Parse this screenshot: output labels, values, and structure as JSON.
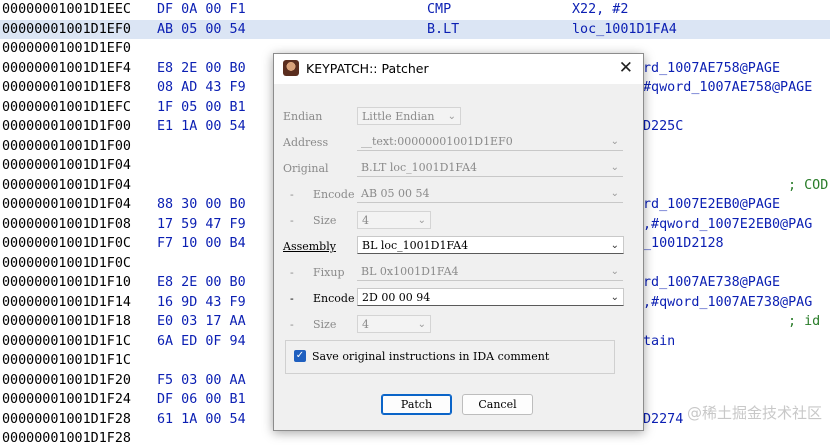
{
  "listing": {
    "rows": [
      {
        "addr": "00000001001D1EEC",
        "bytes": "DF 0A 00 F1",
        "mnem": "CMP",
        "oper": "X22, #2",
        "tail": "",
        "cmt": ""
      },
      {
        "addr": "00000001001D1EF0",
        "bytes": "AB 05 00 54",
        "mnem": "B.LT",
        "oper": "loc_1001D1FA4",
        "tail": "",
        "cmt": ""
      },
      {
        "addr": "00000001001D1EF0",
        "bytes": "",
        "mnem": "",
        "oper": "",
        "tail": "",
        "cmt": ""
      },
      {
        "addr": "00000001001D1EF4",
        "bytes": "E8 2E 00 B0",
        "mnem": "",
        "oper": "",
        "tail": "rd_1007AE758@PAGE",
        "cmt": ""
      },
      {
        "addr": "00000001001D1EF8",
        "bytes": "08 AD 43 F9",
        "mnem": "",
        "oper": "",
        "tail": "#qword_1007AE758@PAGE",
        "cmt": ""
      },
      {
        "addr": "00000001001D1EFC",
        "bytes": "1F 05 00 B1",
        "mnem": "",
        "oper": "",
        "tail": "",
        "cmt": ""
      },
      {
        "addr": "00000001001D1F00",
        "bytes": "E1 1A 00 54",
        "mnem": "",
        "oper": "",
        "tail": "D225C",
        "cmt": ""
      },
      {
        "addr": "00000001001D1F00",
        "bytes": "",
        "mnem": "",
        "oper": "",
        "tail": "",
        "cmt": ""
      },
      {
        "addr": "00000001001D1F04",
        "bytes": "",
        "mnem": "",
        "oper": "",
        "tail": "",
        "cmt": ""
      },
      {
        "addr": "00000001001D1F04",
        "bytes": "",
        "mnem": "",
        "oper": "",
        "tail": "",
        "cmt": "; COD"
      },
      {
        "addr": "00000001001D1F04",
        "bytes": "88 30 00 B0",
        "mnem": "",
        "oper": "",
        "tail": "rd_1007E2EB0@PAGE",
        "cmt": ""
      },
      {
        "addr": "00000001001D1F08",
        "bytes": "17 59 47 F9",
        "mnem": "",
        "oper": "",
        "tail": ",#qword_1007E2EB0@PAG",
        "cmt": ""
      },
      {
        "addr": "00000001001D1F0C",
        "bytes": "F7 10 00 B4",
        "mnem": "",
        "oper": "",
        "tail": "_1001D2128",
        "cmt": ""
      },
      {
        "addr": "00000001001D1F0C",
        "bytes": "",
        "mnem": "",
        "oper": "",
        "tail": "",
        "cmt": ""
      },
      {
        "addr": "00000001001D1F10",
        "bytes": "E8 2E 00 B0",
        "mnem": "",
        "oper": "",
        "tail": "rd_1007AE738@PAGE",
        "cmt": ""
      },
      {
        "addr": "00000001001D1F14",
        "bytes": "16 9D 43 F9",
        "mnem": "",
        "oper": "",
        "tail": ",#qword_1007AE738@PAG",
        "cmt": ""
      },
      {
        "addr": "00000001001D1F18",
        "bytes": "E0 03 17 AA",
        "mnem": "",
        "oper": "",
        "tail": "",
        "cmt": "; id"
      },
      {
        "addr": "00000001001D1F1C",
        "bytes": "6A ED 0F 94",
        "mnem": "",
        "oper": "",
        "tail": "tain",
        "cmt": ""
      },
      {
        "addr": "00000001001D1F1C",
        "bytes": "",
        "mnem": "",
        "oper": "",
        "tail": "",
        "cmt": ""
      },
      {
        "addr": "00000001001D1F20",
        "bytes": "F5 03 00 AA",
        "mnem": "",
        "oper": "",
        "tail": "",
        "cmt": ""
      },
      {
        "addr": "00000001001D1F24",
        "bytes": "DF 06 00 B1",
        "mnem": "",
        "oper": "",
        "tail": "",
        "cmt": ""
      },
      {
        "addr": "00000001001D1F28",
        "bytes": "61 1A 00 54",
        "mnem": "",
        "oper": "",
        "tail": "D2274",
        "cmt": ""
      },
      {
        "addr": "00000001001D1F28",
        "bytes": "",
        "mnem": "",
        "oper": "",
        "tail": "",
        "cmt": ""
      }
    ],
    "highlighted_index": 1,
    "watermark": "@稀土掘金技术社区"
  },
  "dialog": {
    "title": "KEYPATCH:: Patcher",
    "close_glyph": "✕",
    "endian": {
      "label": "Endian",
      "value": "Little Endian"
    },
    "address": {
      "label": "Address",
      "value": "__text:00000001001D1EF0"
    },
    "original": {
      "label": "Original",
      "value": "B.LT loc_1001D1FA4"
    },
    "orig_encode": {
      "dash": "-",
      "label": "Encode",
      "value": "AB 05 00 54"
    },
    "orig_size": {
      "dash": "-",
      "label": "Size",
      "value": "4"
    },
    "assembly": {
      "label": "Assembly",
      "value": "BL loc_1001D1FA4"
    },
    "fixup": {
      "dash": "-",
      "label": "Fixup",
      "value": "BL 0x1001D1FA4"
    },
    "new_encode": {
      "dash": "-",
      "label": "Encode",
      "value": "2D 00 00 94"
    },
    "new_size": {
      "dash": "-",
      "label": "Size",
      "value": "4"
    },
    "save_comment": {
      "label": "Save original instructions in IDA comment",
      "checked": true
    },
    "patch_button": "Patch",
    "cancel_button": "Cancel",
    "chevron": "⌄"
  }
}
